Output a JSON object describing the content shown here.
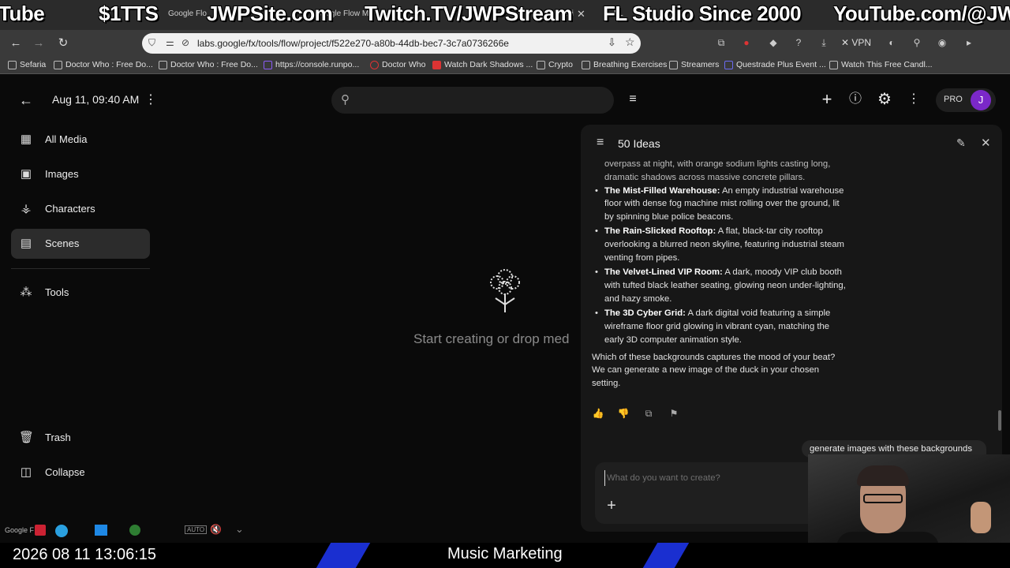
{
  "overlay": {
    "top_texts": [
      "Tube",
      "$1TTS",
      "JWPSite.com",
      "Twitch.TV/JWPStream",
      "FL Studio Since 2000",
      "YouTube.com/@JWP"
    ],
    "tab_fragments": [
      "Google Flo",
      "Google Flow M",
      "Studi",
      "FL"
    ],
    "clock": "2026 08 11 13:06:15",
    "music_label": "Music Marketing",
    "taskbar_label": "Google F"
  },
  "browser": {
    "url": "labs.google/fx/tools/flow/project/f522e270-a80b-44db-bec7-3c7a0736266e",
    "vpn_label": "VPN",
    "bookmarks": [
      "Sefaria",
      "Doctor Who : Free Do...",
      "Doctor Who : Free Do...",
      "https://console.runpo...",
      "Doctor Who",
      "Watch Dark Shadows ...",
      "Crypto",
      "Breathing Exercises",
      "Streamers",
      "Questrade Plus Event ...",
      "Watch This Free Candl..."
    ]
  },
  "app": {
    "date_label": "Aug 11, 09:40 AM",
    "pro_label": "PRO",
    "avatar_letter": "J",
    "sidebar": {
      "items": [
        {
          "label": "All Media",
          "icon": "grid-icon"
        },
        {
          "label": "Images",
          "icon": "image-icon"
        },
        {
          "label": "Characters",
          "icon": "person-icon"
        },
        {
          "label": "Scenes",
          "icon": "clapper-icon",
          "active": true
        },
        {
          "label": "Tools",
          "icon": "sparkle-grid-icon"
        },
        {
          "label": "Trash",
          "icon": "trash-icon"
        },
        {
          "label": "Collapse",
          "icon": "collapse-icon"
        }
      ]
    },
    "empty_state": "Start creating or drop med"
  },
  "chat": {
    "title": "50 Ideas",
    "fragment": "overpass at night, with orange sodium lights casting long, dramatic shadows across massive concrete pillars.",
    "ideas": [
      {
        "name": "The Mist-Filled Warehouse:",
        "text": " An empty industrial warehouse floor with dense fog machine mist rolling over the ground, lit by spinning blue police beacons."
      },
      {
        "name": "The Rain-Slicked Rooftop:",
        "text": " A flat, black-tar city rooftop overlooking a blurred neon skyline, featuring industrial steam venting from pipes."
      },
      {
        "name": "The Velvet-Lined VIP Room:",
        "text": " A dark, moody VIP club booth with tufted black leather seating, glowing neon under-lighting, and hazy smoke."
      },
      {
        "name": "The 3D Cyber Grid:",
        "text": " A dark digital void featuring a simple wireframe floor grid glowing in vibrant cyan, matching the early 3D computer animation style."
      }
    ],
    "question": "Which of these backgrounds captures the mood of your beat? We can generate a new image of the duck in your chosen setting.",
    "user_message": "generate images with these backgrounds",
    "input_placeholder": "What do you want to create?"
  }
}
